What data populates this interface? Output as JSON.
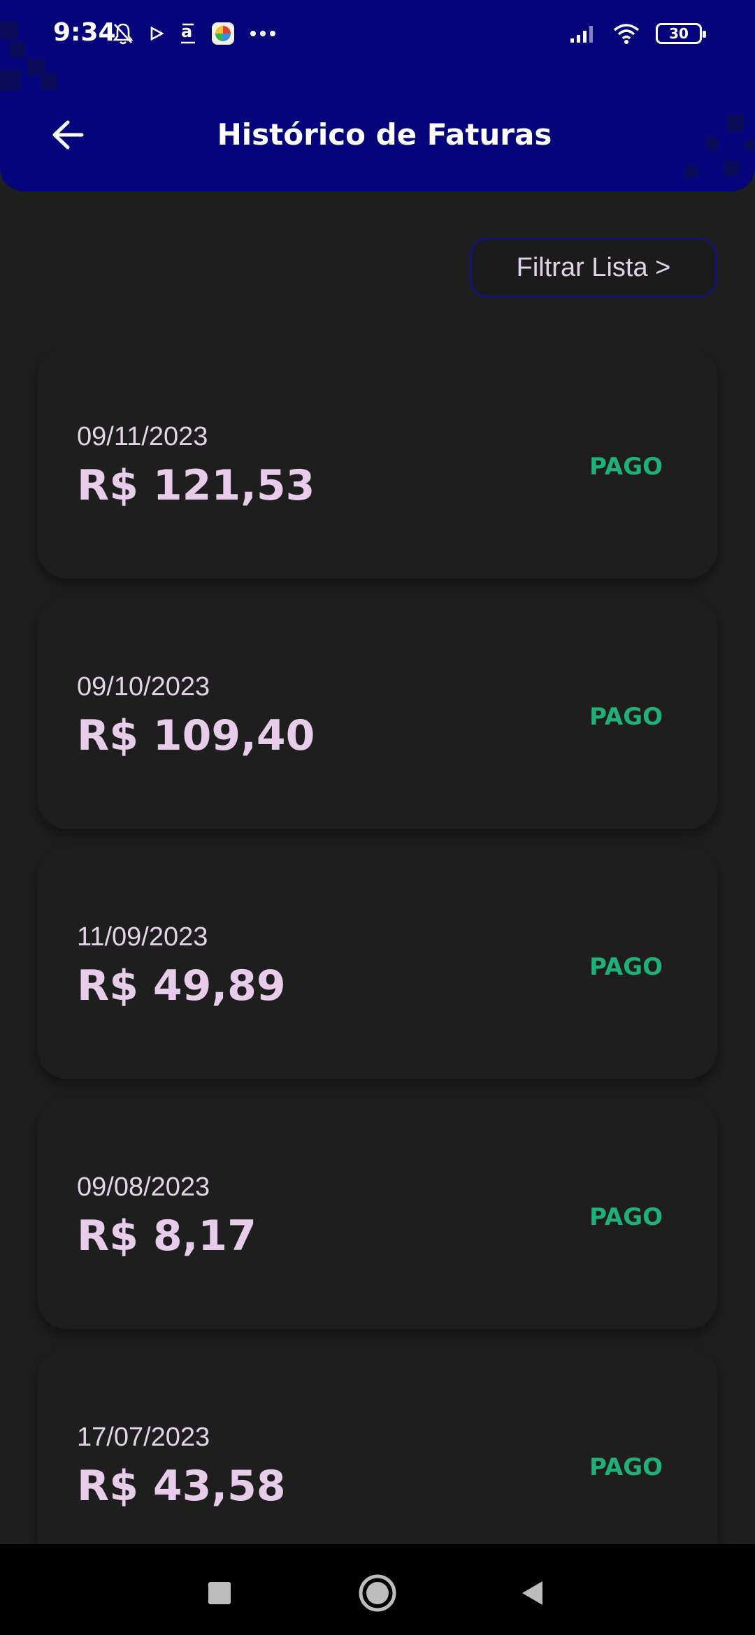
{
  "status_bar": {
    "time": "9:34",
    "battery": "30",
    "icons_left": [
      "mute-bell-icon",
      "play-icon",
      "amazon-icon",
      "app-color-icon",
      "more-dots-icon"
    ],
    "icons_right": [
      "signal-icon",
      "wifi-icon",
      "battery-icon"
    ]
  },
  "header": {
    "title": "Histórico de Faturas",
    "back_icon": "arrow-left-icon",
    "color": "#05047a"
  },
  "filter": {
    "label": "Filtrar Lista >"
  },
  "invoices": [
    {
      "date": "09/11/2023",
      "amount": "R$ 121,53",
      "status": "PAGO"
    },
    {
      "date": "09/10/2023",
      "amount": "R$ 109,40",
      "status": "PAGO"
    },
    {
      "date": "11/09/2023",
      "amount": "R$ 49,89",
      "status": "PAGO"
    },
    {
      "date": "09/08/2023",
      "amount": "R$ 8,17",
      "status": "PAGO"
    },
    {
      "date": "17/07/2023",
      "amount": "R$ 43,58",
      "status": "PAGO"
    }
  ],
  "colors": {
    "background": "#1f1f1f",
    "card": "#1e1e1e",
    "amount": "#e7cde9",
    "status_paid": "#20b07a"
  },
  "nav": {
    "icons": [
      "recents-square-icon",
      "home-circle-icon",
      "back-triangle-icon"
    ]
  }
}
